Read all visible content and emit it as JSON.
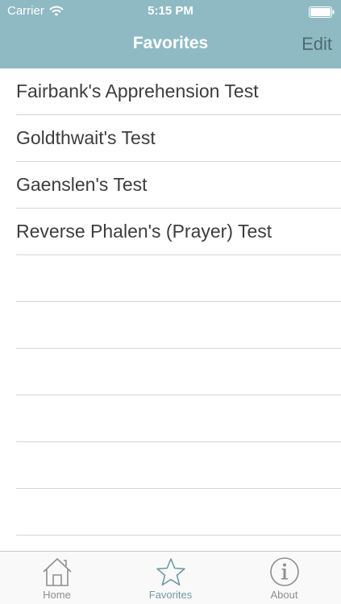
{
  "status_bar": {
    "carrier": "Carrier",
    "time": "5:15 PM",
    "icons": [
      "wifi-icon",
      "battery-icon"
    ]
  },
  "nav": {
    "title": "Favorites",
    "edit_label": "Edit"
  },
  "favorites": [
    "Fairbank's Apprehension Test",
    "Goldthwait's Test",
    "Gaenslen's Test",
    "Reverse Phalen's (Prayer) Test"
  ],
  "tabs": [
    {
      "label": "Home",
      "icon": "home-icon",
      "active": false
    },
    {
      "label": "Favorites",
      "icon": "star-icon",
      "active": true
    },
    {
      "label": "About",
      "icon": "info-icon",
      "active": false
    }
  ],
  "colors": {
    "header_background": "#8fbac4",
    "header_title": "#ffffff",
    "edit_button": "#4f6a71",
    "tab_active": "#6f9aa7",
    "tab_inactive": "#8e8e8e"
  }
}
